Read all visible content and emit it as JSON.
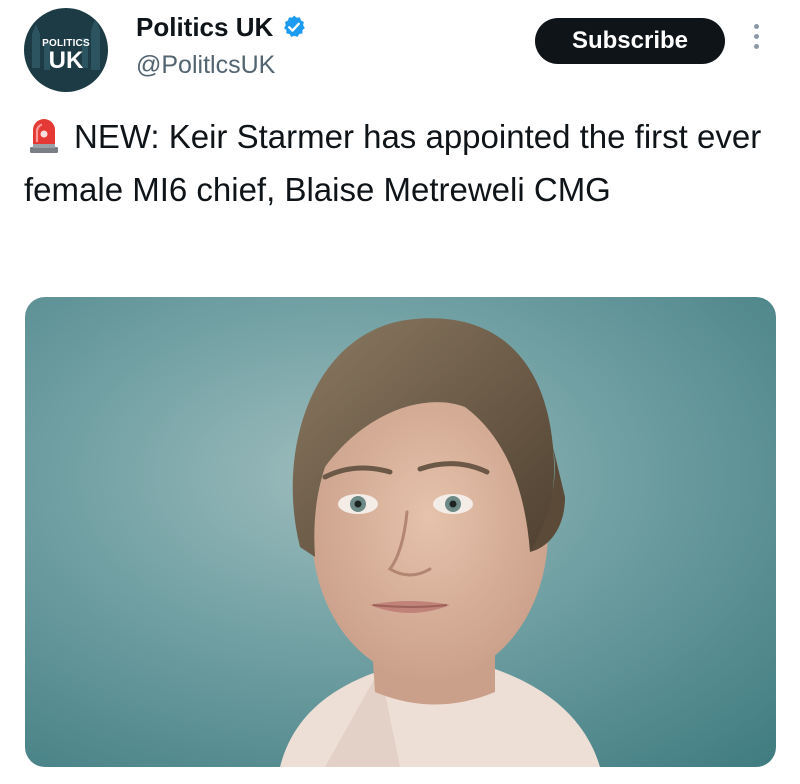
{
  "account": {
    "display_name": "Politics UK",
    "handle": "@PolitlcsUK",
    "avatar": {
      "top_text": "POLITICS",
      "main_text": "UK"
    },
    "verified_icon": "verified-badge-icon"
  },
  "actions": {
    "subscribe_label": "Subscribe",
    "more_icon": "more-vertical-icon"
  },
  "tweet": {
    "emoji": "siren-emoji",
    "text": "NEW: Keir Starmer has appointed the first ever female MI6 chief, Blaise Metreweli CMG"
  },
  "media": {
    "icon": "portrait-photo"
  },
  "colors": {
    "text": "#0f1419",
    "secondary": "#536471",
    "verified": "#1d9bf0",
    "button_bg": "#0f1419",
    "photo_bg": "#5f9598"
  }
}
